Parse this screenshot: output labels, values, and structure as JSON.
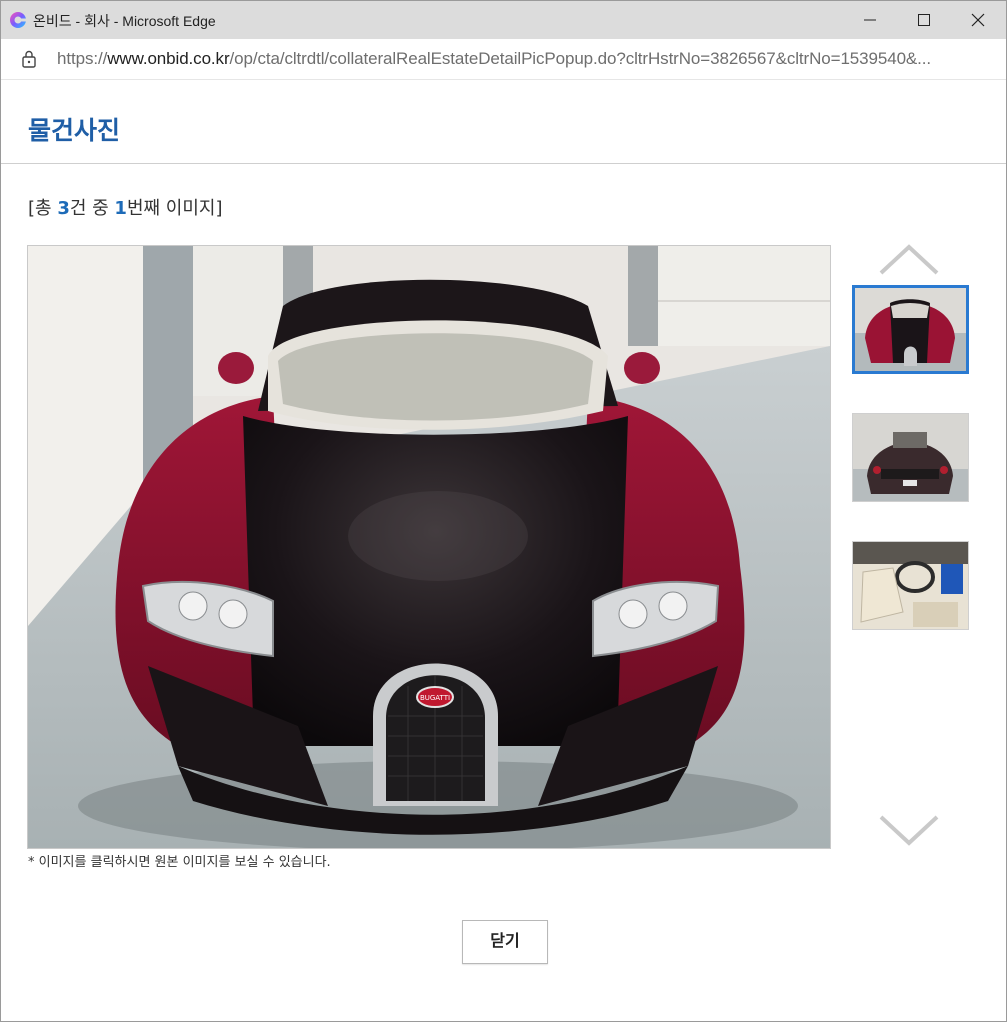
{
  "window": {
    "title": "온비드 - 회사 - Microsoft Edge",
    "url_prefix": "https://",
    "url_host": "www.onbid.co.kr",
    "url_path": "/op/cta/cltrdtl/collateralRealEstateDetailPicPopup.do?cltrHstrNo=3826567&cltrNo=1539540&..."
  },
  "page": {
    "title": "물건사진",
    "counter_open": "[총 ",
    "counter_total": "3",
    "counter_mid": "건 중 ",
    "counter_current": "1",
    "counter_close": "번째 이미지]",
    "note": "* 이미지를 클릭하시면 원본 이미지를 보실 수 있습니다.",
    "close_label": "닫기"
  },
  "photo": {
    "badge_text": "BUGATTI",
    "subject": "car-front-photo"
  },
  "thumbnails": [
    {
      "name": "thumb-car-front",
      "active": true
    },
    {
      "name": "thumb-car-rear",
      "active": false
    },
    {
      "name": "thumb-car-interior",
      "active": false
    }
  ],
  "colors": {
    "title_blue": "#1f5ea6",
    "highlight_blue": "#1d6bb8",
    "active_border": "#2a7ad1"
  }
}
